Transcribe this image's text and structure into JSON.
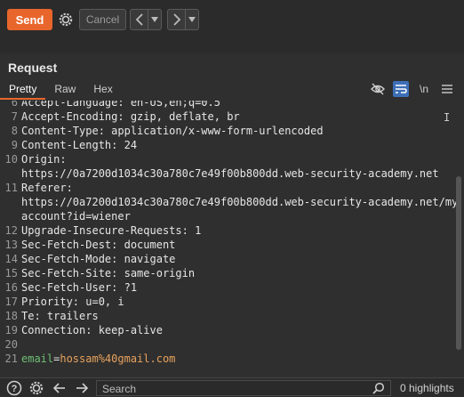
{
  "toolbar": {
    "send_label": "Send",
    "cancel_label": "Cancel",
    "prev_label": "<",
    "next_label": ">",
    "dropdown_glyph": "▾"
  },
  "panel": {
    "title": "Request",
    "tabs": [
      "Pretty",
      "Raw",
      "Hex"
    ],
    "active_tab": "Pretty",
    "tools": {
      "hide_icon": "eye-off-icon",
      "wrap_icon": "word-wrap-icon",
      "newline_label": "\\n",
      "menu_icon": "hamburger-menu-icon"
    }
  },
  "lines": [
    {
      "n": "6",
      "text": "Accept-Language: en-US,en;q=0.5"
    },
    {
      "n": "7",
      "text": "Accept-Encoding: gzip, deflate, br"
    },
    {
      "n": "8",
      "text": "Content-Type: application/x-www-form-urlencoded"
    },
    {
      "n": "9",
      "text": "Content-Length: 24"
    },
    {
      "n": "10",
      "text": "Origin:"
    },
    {
      "n": "",
      "text": "https://0a7200d1034c30a780c7e49f00b800dd.web-security-academy.net"
    },
    {
      "n": "11",
      "text": "Referer:"
    },
    {
      "n": "",
      "text": "https://0a7200d1034c30a780c7e49f00b800dd.web-security-academy.net/my"
    },
    {
      "n": "",
      "text": "account?id=wiener"
    },
    {
      "n": "12",
      "text": "Upgrade-Insecure-Requests: 1"
    },
    {
      "n": "13",
      "text": "Sec-Fetch-Dest: document"
    },
    {
      "n": "14",
      "text": "Sec-Fetch-Mode: navigate"
    },
    {
      "n": "15",
      "text": "Sec-Fetch-Site: same-origin"
    },
    {
      "n": "16",
      "text": "Sec-Fetch-User: ?1"
    },
    {
      "n": "17",
      "text": "Priority: u=0, i"
    },
    {
      "n": "18",
      "text": "Te: trailers"
    },
    {
      "n": "19",
      "text": "Connection: keep-alive"
    },
    {
      "n": "20",
      "text": ""
    },
    {
      "n": "21",
      "body_key": "email",
      "body_eq": "=",
      "body_value": "hossam%40gmail.com"
    }
  ],
  "bottom": {
    "help_icon": "help-icon",
    "settings_icon": "gear-icon",
    "back_icon": "arrow-left-icon",
    "forward_icon": "arrow-right-icon",
    "search_placeholder": "Search",
    "search_value": "",
    "highlights_label": "0 highlights"
  },
  "colors": {
    "accent": "#e8662c",
    "active_tool": "#3d6fb8",
    "body_key": "#6fbf73",
    "body_value": "#e8a25c"
  }
}
